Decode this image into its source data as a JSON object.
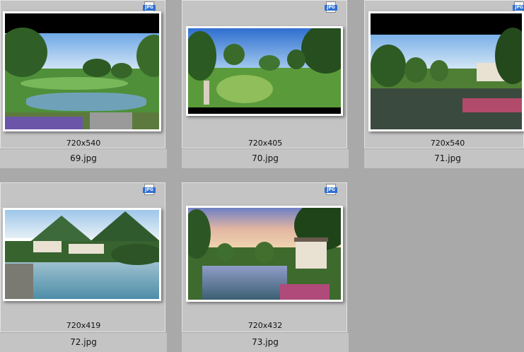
{
  "files": [
    {
      "name": "69.jpg",
      "dims": "720x540",
      "badge": "JPG"
    },
    {
      "name": "70.jpg",
      "dims": "720x405",
      "badge": "JPG"
    },
    {
      "name": "71.jpg",
      "dims": "720x540",
      "badge": "JPG"
    },
    {
      "name": "72.jpg",
      "dims": "720x419",
      "badge": "JPG"
    },
    {
      "name": "73.jpg",
      "dims": "720x432",
      "badge": "JPG"
    }
  ],
  "colors": {
    "background": "#a9a9a9",
    "tile": "#c4c4c4",
    "jpg_badge": "#2f6fd1"
  }
}
